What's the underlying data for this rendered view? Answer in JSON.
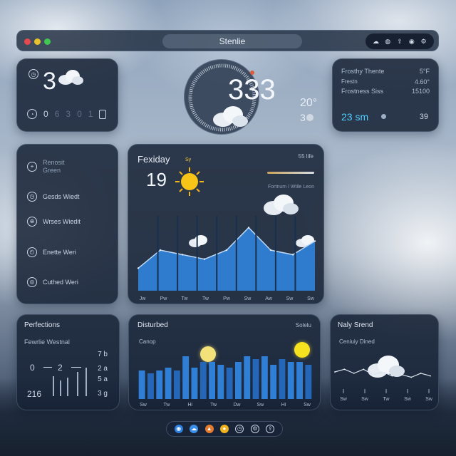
{
  "window": {
    "title": "Stenlie",
    "toolbar_icons": [
      "cloud-icon",
      "chat-icon",
      "share-icon",
      "user-icon",
      "settings-icon"
    ],
    "traffic_colors": [
      "#e5484d",
      "#e8c22a",
      "#3ec84f"
    ]
  },
  "current": {
    "temp": "3",
    "meta": [
      "0",
      "6",
      "3",
      "0",
      "1"
    ]
  },
  "dial": {
    "value": "333",
    "side_top": "20°",
    "side_bottom": "3"
  },
  "stats": {
    "rows": [
      {
        "label": "Frosthy Thente",
        "value": "5°F"
      },
      {
        "label": "Frestn",
        "value": "4.60°"
      },
      {
        "label": "Frostness Siss",
        "value": "15100"
      }
    ],
    "highlight_time": "23 sm",
    "highlight_count": "39",
    "highlight_color": "#4fd0ff"
  },
  "sidebar": {
    "items": [
      {
        "icon": "compass-icon",
        "label": "Renosit\nGreen"
      },
      {
        "icon": "clock-icon",
        "label": "Gesds Wiedt"
      },
      {
        "icon": "globe-icon",
        "label": "Wrses Wiedit"
      },
      {
        "icon": "timer-icon",
        "label": "Enette Weri"
      },
      {
        "icon": "location-icon",
        "label": "Cuthed Weri"
      }
    ]
  },
  "forecast": {
    "day": "Fexiday",
    "temp": "19",
    "sun_label": "Sy",
    "right_top": "55 life",
    "right_sub": "Fortnum / Wtile Leon",
    "x_labels": [
      "Jw",
      "Pw",
      "Tw",
      "Tw",
      "Pw",
      "Sw",
      "Aw",
      "Sw",
      "Sw"
    ],
    "chart_data": {
      "type": "area",
      "categories": [
        "Jw",
        "Pw",
        "Tw",
        "Tw",
        "Pw",
        "Sw",
        "Aw",
        "Sw",
        "Sw"
      ],
      "values": [
        2.5,
        4.5,
        4,
        3.5,
        4.5,
        7,
        4.5,
        4,
        5.5
      ],
      "ylim": [
        0,
        10
      ],
      "color": "#2f7fd6"
    }
  },
  "perfections": {
    "title": "Perfections",
    "subtitle": "Fewrlie Westnal",
    "left_values": [
      "0",
      "2",
      "216"
    ],
    "right_values": [
      "7 b",
      "2 a",
      "5 a",
      "3 g"
    ]
  },
  "disturbed": {
    "title": "Disturbed",
    "right_label": "Solelu",
    "subtitle": "Canop",
    "x_labels": [
      "Sw",
      "Tw",
      "Hi",
      "Tw",
      "Dw",
      "Sw",
      "Hi",
      "Sw"
    ],
    "chart_data": {
      "type": "bar",
      "values": [
        5,
        4.5,
        5,
        5.5,
        5,
        7.5,
        5.5,
        6.5,
        6.5,
        6,
        5.5,
        6.5,
        7.5,
        7,
        7.5,
        6,
        7,
        6.5,
        6.5,
        6
      ],
      "ylim": [
        0,
        10
      ],
      "color": "#2f7fd6"
    }
  },
  "daily_trend": {
    "title": "Naly Srend",
    "subtitle": "Ceniuiy Dined",
    "x_labels": [
      "Sw",
      "Sw",
      "Tw",
      "Sw",
      "Sw"
    ],
    "chart_data": {
      "type": "line",
      "values": [
        4,
        5,
        3.5,
        5,
        3,
        4,
        2.5,
        3,
        2,
        3.5,
        2.5
      ],
      "ylim": [
        0,
        8
      ],
      "color": "#d8e2ee"
    }
  },
  "dock": {
    "icons": [
      "browser-icon",
      "weather-icon",
      "maps-icon",
      "sun-icon",
      "clock-icon",
      "settings-icon",
      "share-icon"
    ]
  }
}
